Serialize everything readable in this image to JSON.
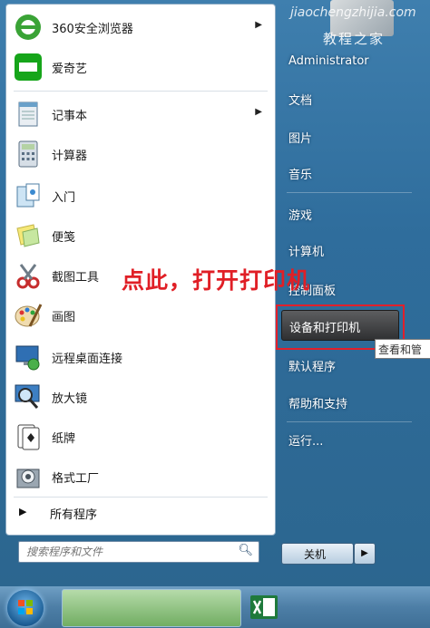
{
  "watermark": {
    "domain": "jiaochengzhijia.com",
    "name": "教程之家"
  },
  "left_panel": {
    "programs": [
      {
        "label": "360安全浏览器",
        "icon": "360-browser-icon",
        "has_arrow": true
      },
      {
        "label": "爱奇艺",
        "icon": "iqiyi-icon",
        "has_arrow": false
      },
      {
        "label": "记事本",
        "icon": "notepad-icon",
        "has_arrow": true
      },
      {
        "label": "计算器",
        "icon": "calculator-icon",
        "has_arrow": false
      },
      {
        "label": "入门",
        "icon": "getting-started-icon",
        "has_arrow": false
      },
      {
        "label": "便笺",
        "icon": "sticky-notes-icon",
        "has_arrow": false
      },
      {
        "label": "截图工具",
        "icon": "snipping-tool-icon",
        "has_arrow": false
      },
      {
        "label": "画图",
        "icon": "paint-icon",
        "has_arrow": false
      },
      {
        "label": "远程桌面连接",
        "icon": "remote-desktop-icon",
        "has_arrow": false
      },
      {
        "label": "放大镜",
        "icon": "magnifier-icon",
        "has_arrow": false
      },
      {
        "label": "纸牌",
        "icon": "solitaire-icon",
        "has_arrow": false
      },
      {
        "label": "格式工厂",
        "icon": "format-factory-icon",
        "has_arrow": false
      }
    ],
    "arrow_glyph": "▶",
    "all_programs": "所有程序",
    "all_programs_glyph": "▶",
    "search_placeholder": "搜索程序和文件"
  },
  "right_panel": {
    "username": "Administrator",
    "items": [
      "文档",
      "图片",
      "音乐",
      "游戏",
      "计算机",
      "控制面板",
      "设备和打印机",
      "默认程序",
      "帮助和支持",
      "运行..."
    ],
    "tooltip": "查看和管",
    "shutdown": "关机",
    "shutdown_arrow": "▶"
  },
  "annotation": "点此，打开打印机",
  "colors": {
    "annotation": "#e01f26",
    "highlight_box": "#e1202b",
    "panel_blue": "#2f6d9c"
  }
}
